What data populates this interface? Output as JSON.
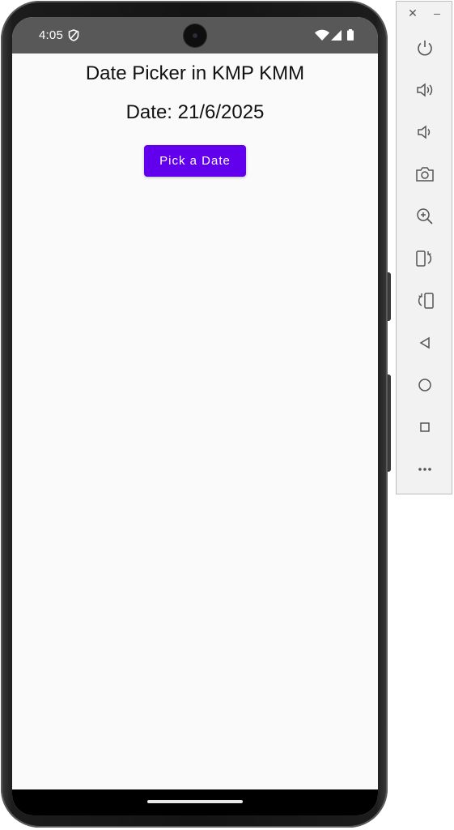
{
  "status_bar": {
    "time": "4:05"
  },
  "app": {
    "title": "Date Picker in KMP KMM",
    "date_text": "Date: 21/6/2025",
    "button_label": "Pick a Date",
    "accent_color": "#6200ee",
    "background_color": "#fafafa"
  },
  "emulator_toolbar": {
    "window_controls": [
      "close-icon",
      "minimize-icon"
    ],
    "buttons": [
      "power-icon",
      "volume-up-icon",
      "volume-down-icon",
      "camera-icon",
      "zoom-icon",
      "rotate-left-icon",
      "rotate-right-icon",
      "back-icon",
      "home-icon",
      "overview-icon",
      "more-icon"
    ]
  }
}
